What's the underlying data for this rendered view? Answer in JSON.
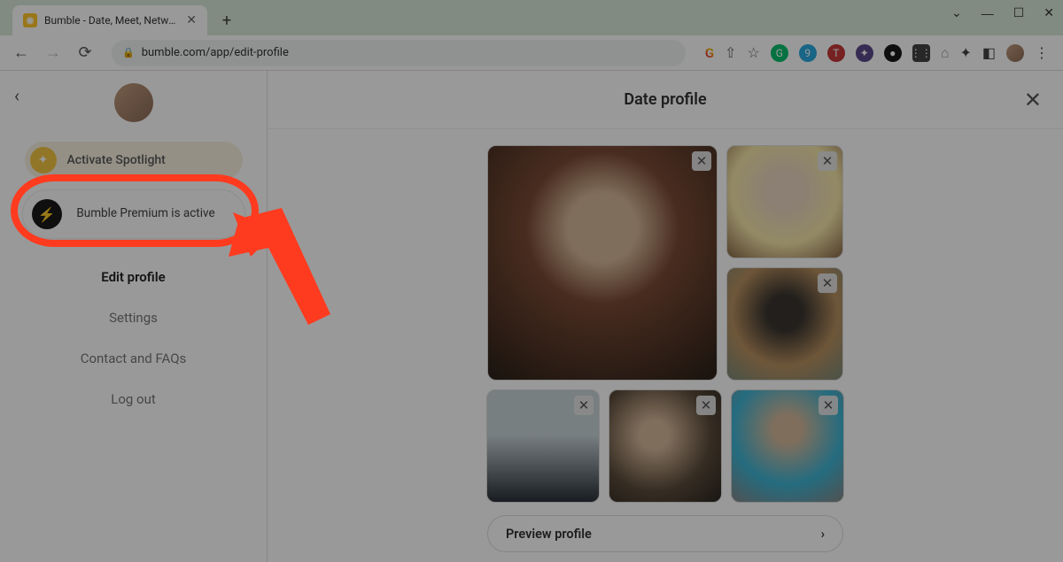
{
  "browser": {
    "tab_title": "Bumble - Date, Meet, Network B…",
    "url": "bumble.com/app/edit-profile"
  },
  "sidebar": {
    "spotlight_label": "Activate Spotlight",
    "premium_label": "Bumble Premium is active",
    "items": [
      {
        "label": "Edit profile",
        "active": true
      },
      {
        "label": "Settings",
        "active": false
      },
      {
        "label": "Contact and FAQs",
        "active": false
      },
      {
        "label": "Log out",
        "active": false
      }
    ]
  },
  "main": {
    "header_title": "Date profile",
    "preview_label": "Preview profile"
  },
  "icons": {
    "spotlight": "✦",
    "premium": "⚡",
    "close": "✕",
    "chevron_right": "›",
    "chevron_left": "‹",
    "lock": "🔒"
  }
}
